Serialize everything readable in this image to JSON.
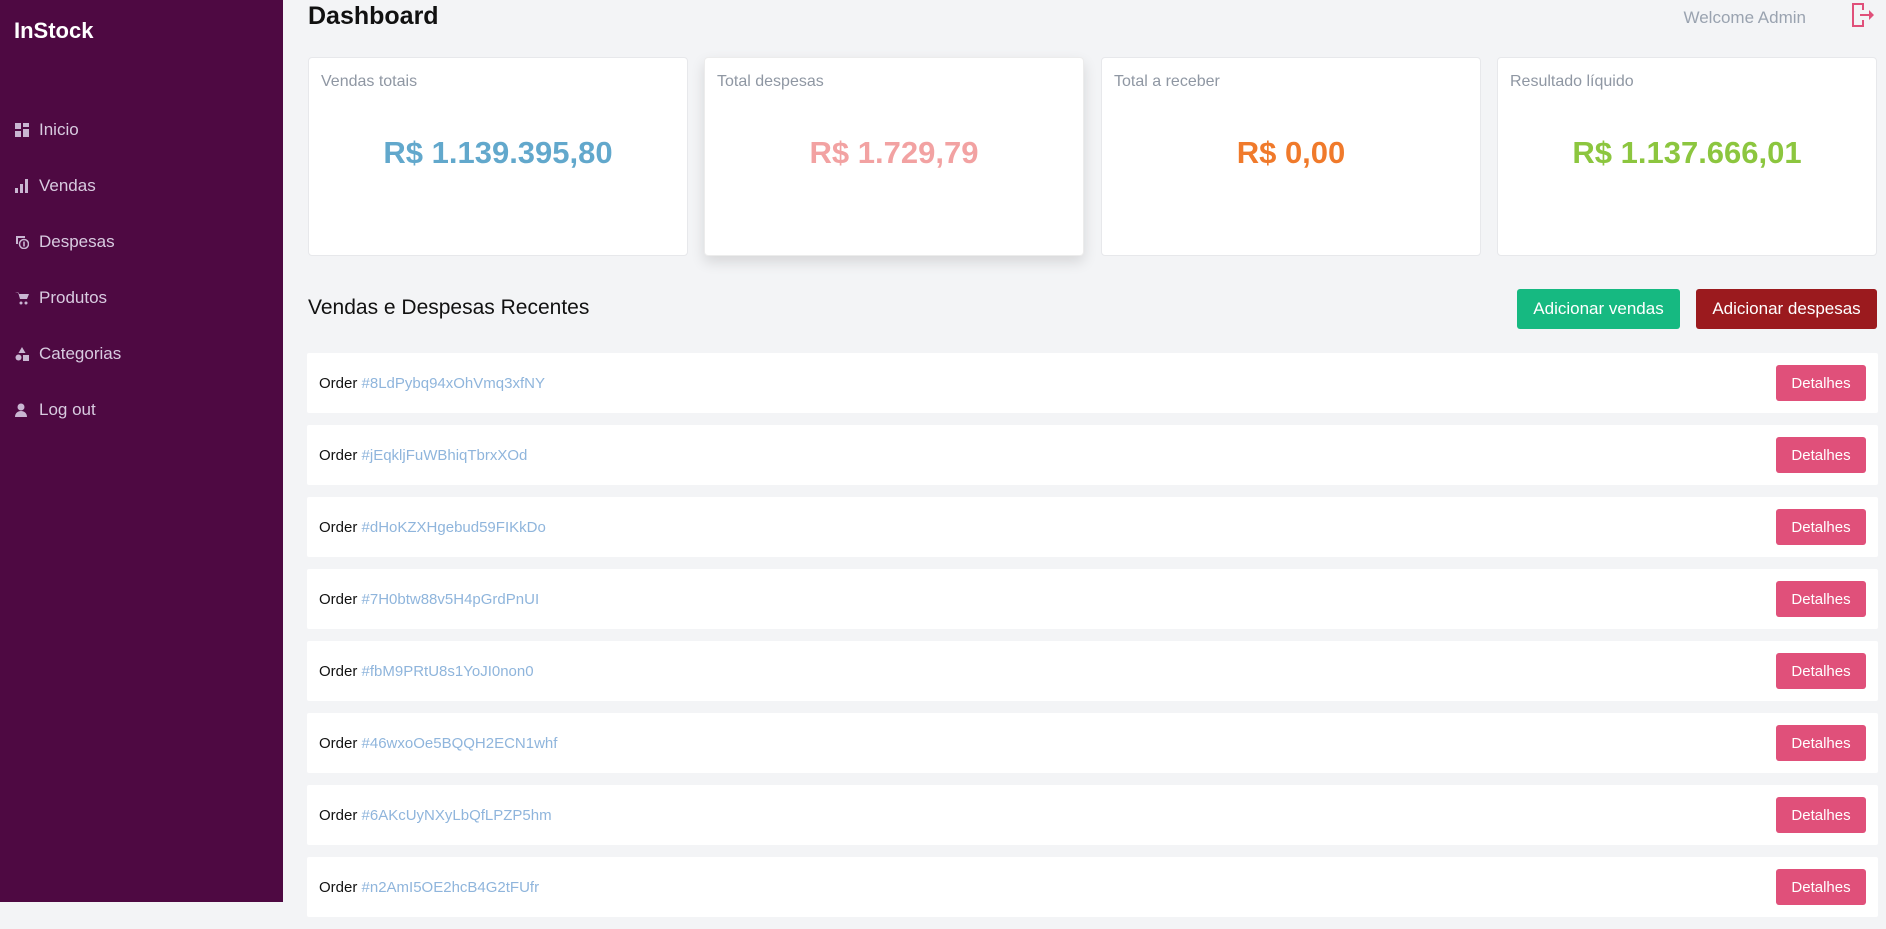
{
  "brand": "InStock",
  "nav": [
    {
      "label": "Inicio",
      "icon": "grid-icon"
    },
    {
      "label": "Vendas",
      "icon": "bar-chart-icon"
    },
    {
      "label": "Despesas",
      "icon": "money-icon"
    },
    {
      "label": "Produtos",
      "icon": "cart-icon"
    },
    {
      "label": "Categorias",
      "icon": "shapes-icon"
    },
    {
      "label": "Log out",
      "icon": "user-icon"
    }
  ],
  "header": {
    "title": "Dashboard",
    "welcome": "Welcome Admin",
    "logout_icon": "logout-icon"
  },
  "cards": [
    {
      "label": "Vendas totais",
      "value": "R$ 1.139.395,80",
      "color": "#62a8cc"
    },
    {
      "label": "Total despesas",
      "value": "R$ 1.729,79",
      "color": "#f2a2a2"
    },
    {
      "label": "Total a receber",
      "value": "R$ 0,00",
      "color": "#f07a2b"
    },
    {
      "label": "Resultado líquido",
      "value": "R$ 1.137.666,01",
      "color": "#8cc63f"
    }
  ],
  "recent": {
    "title": "Vendas e Despesas Recentes",
    "add_sales_label": "Adicionar vendas",
    "add_expenses_label": "Adicionar despesas",
    "order_prefix": "Order",
    "details_label": "Detalhes",
    "orders": [
      "#8LdPybq94xOhVmq3xfNY",
      "#jEqkljFuWBhiqTbrxXOd",
      "#dHoKZXHgebud59FIKkDo",
      "#7H0btw88v5H4pGrdPnUI",
      "#fbM9PRtU8s1YoJI0non0",
      "#46wxoOe5BQQH2ECN1whf",
      "#6AKcUyNXyLbQfLPZP5hm",
      "#n2AmI5OE2hcB4G2tFUfr"
    ]
  },
  "colors": {
    "sidebar": "#4e0942",
    "add_sales": "#16b981",
    "add_expenses": "#9b1a1e",
    "details": "#e0507a",
    "order_id": "#8fb5dc"
  }
}
